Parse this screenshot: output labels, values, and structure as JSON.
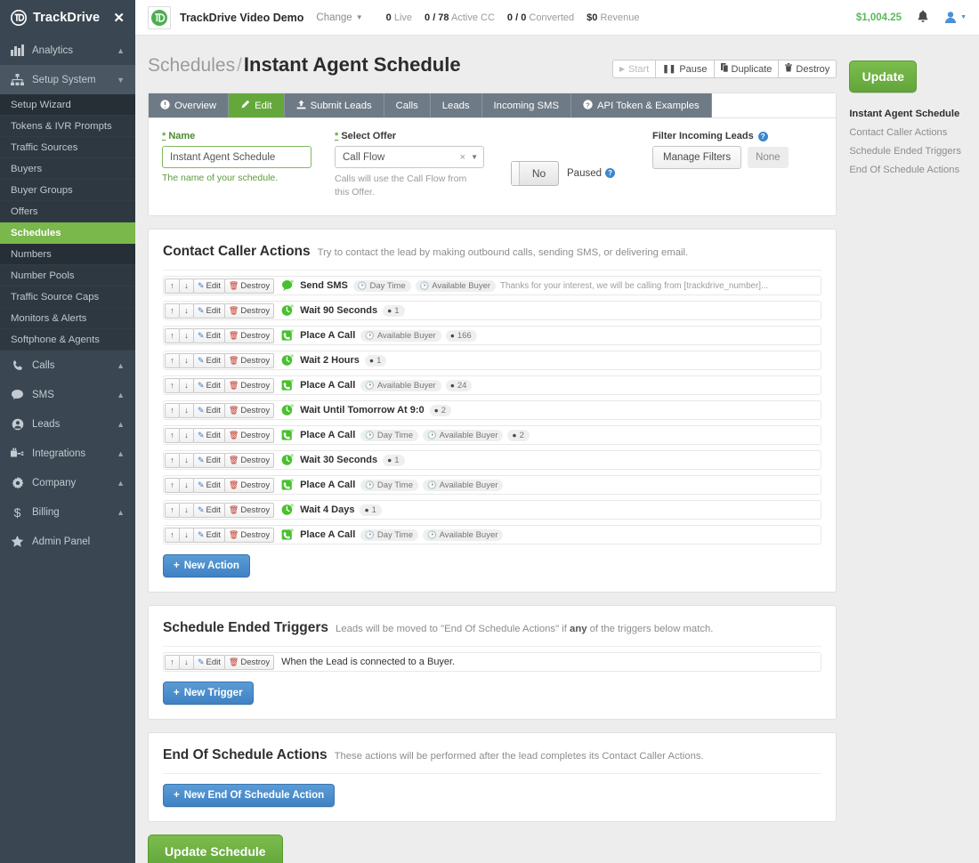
{
  "sidebar": {
    "brand": "TrackDrive",
    "close_icon": "close-icon",
    "groups": [
      {
        "label": "Analytics",
        "icon": "analytics-icon",
        "state": "collapsed"
      },
      {
        "label": "Setup System",
        "icon": "sitemap-icon",
        "state": "expanded"
      }
    ],
    "setup_items": [
      "Setup Wizard",
      "Tokens & IVR Prompts",
      "Traffic Sources",
      "Buyers",
      "Buyer Groups",
      "Offers",
      "Schedules",
      "Numbers",
      "Number Pools",
      "Traffic Source Caps",
      "Monitors & Alerts",
      "Softphone & Agents"
    ],
    "active_item": "Schedules",
    "lower_groups": [
      {
        "label": "Calls",
        "icon": "phone-icon"
      },
      {
        "label": "SMS",
        "icon": "chat-icon"
      },
      {
        "label": "Leads",
        "icon": "user-circle-icon"
      },
      {
        "label": "Integrations",
        "icon": "plug-icon"
      },
      {
        "label": "Company",
        "icon": "gear-icon"
      },
      {
        "label": "Billing",
        "icon": "dollar-icon"
      },
      {
        "label": "Admin Panel",
        "icon": "star-icon"
      }
    ],
    "accent_green": "#7ab84b",
    "bg": "#3a4651"
  },
  "topbar": {
    "tenant": "TrackDrive Video Demo",
    "change_label": "Change",
    "stats": [
      {
        "value": "0",
        "label": "Live"
      },
      {
        "value": "0 / 78",
        "label": "Active CC"
      },
      {
        "value": "0 / 0",
        "label": "Converted"
      },
      {
        "value": "$0",
        "label": "Revenue"
      }
    ],
    "revenue": "$1,004.25",
    "bell_icon": "bell-icon",
    "user_icon": "user-icon"
  },
  "page": {
    "breadcrumb_parent": "Schedules",
    "breadcrumb_sep": "/",
    "title": "Instant Agent Schedule",
    "actions": [
      {
        "label": "Start",
        "icon": "play-icon",
        "disabled": true
      },
      {
        "label": "Pause",
        "icon": "pause-icon",
        "disabled": false
      },
      {
        "label": "Duplicate",
        "icon": "copy-icon",
        "disabled": false
      },
      {
        "label": "Destroy",
        "icon": "trash-icon",
        "disabled": false
      }
    ]
  },
  "tabs": [
    {
      "label": "Overview",
      "icon": "info-icon",
      "active": false
    },
    {
      "label": "Edit",
      "icon": "pencil-icon",
      "active": true
    },
    {
      "label": "Submit Leads",
      "icon": "upload-icon",
      "active": false
    },
    {
      "label": "Calls",
      "icon": "",
      "active": false
    },
    {
      "label": "Leads",
      "icon": "",
      "active": false
    },
    {
      "label": "Incoming SMS",
      "icon": "",
      "active": false
    },
    {
      "label": "API Token & Examples",
      "icon": "question-icon",
      "active": false
    }
  ],
  "form": {
    "name_label": "Name",
    "name_value": "Instant Agent Schedule",
    "name_help": "The name of your schedule.",
    "offer_label": "Select Offer",
    "offer_value": "Call Flow",
    "offer_help": "Calls will use the Call Flow from this Offer.",
    "paused_toggle_value": "No",
    "paused_label": "Paused",
    "filter_label": "Filter Incoming Leads",
    "manage_filters_label": "Manage Filters",
    "filter_status": "None",
    "required_mark": "*"
  },
  "contact_caller_actions": {
    "title": "Contact Caller Actions",
    "subtitle": "Try to contact the lead by making outbound calls, sending SMS, or delivering email.",
    "row_buttons": {
      "up": "↑",
      "down": "↓",
      "edit": "Edit",
      "destroy": "Destroy"
    },
    "new_button": "New Action",
    "rows": [
      {
        "icon": "sms-bubble-icon",
        "name": "Send SMS",
        "chips": [
          "Day Time",
          "Available Buyer"
        ],
        "counts": [],
        "preview": "Thanks for your interest, we will be calling from [trackdrive_number]..."
      },
      {
        "icon": "clock-icon",
        "name": "Wait 90 Seconds",
        "chips": [],
        "counts": [
          "1"
        ],
        "preview": ""
      },
      {
        "icon": "phone-square-icon",
        "name": "Place A Call",
        "chips": [
          "Available Buyer"
        ],
        "counts": [
          "166"
        ],
        "preview": ""
      },
      {
        "icon": "clock-icon",
        "name": "Wait 2 Hours",
        "chips": [],
        "counts": [
          "1"
        ],
        "preview": ""
      },
      {
        "icon": "phone-square-icon",
        "name": "Place A Call",
        "chips": [
          "Available Buyer"
        ],
        "counts": [
          "24"
        ],
        "preview": ""
      },
      {
        "icon": "clock-icon",
        "name": "Wait Until Tomorrow At 9:0",
        "chips": [],
        "counts": [
          "2"
        ],
        "preview": ""
      },
      {
        "icon": "phone-square-icon",
        "name": "Place A Call",
        "chips": [
          "Day Time",
          "Available Buyer"
        ],
        "counts": [
          "2"
        ],
        "preview": ""
      },
      {
        "icon": "clock-icon",
        "name": "Wait 30 Seconds",
        "chips": [],
        "counts": [
          "1"
        ],
        "preview": ""
      },
      {
        "icon": "phone-square-icon",
        "name": "Place A Call",
        "chips": [
          "Day Time",
          "Available Buyer"
        ],
        "counts": [],
        "preview": ""
      },
      {
        "icon": "clock-icon",
        "name": "Wait 4 Days",
        "chips": [],
        "counts": [
          "1"
        ],
        "preview": ""
      },
      {
        "icon": "phone-square-icon",
        "name": "Place A Call",
        "chips": [
          "Day Time",
          "Available Buyer"
        ],
        "counts": [],
        "preview": ""
      }
    ]
  },
  "schedule_ended_triggers": {
    "title": "Schedule Ended Triggers",
    "subtitle_pre": "Leads will be moved to \"End Of Schedule Actions\" if ",
    "subtitle_bold": "any",
    "subtitle_post": " of the triggers below match.",
    "new_button": "New Trigger",
    "rows": [
      {
        "text": "When the Lead is connected to a Buyer."
      }
    ]
  },
  "end_of_schedule_actions": {
    "title": "End Of Schedule Actions",
    "subtitle": "These actions will be performed after the lead completes its Contact Caller Actions.",
    "new_button": "New End Of Schedule Action"
  },
  "footer": {
    "update_schedule_label": "Update Schedule"
  },
  "rail": {
    "update_label": "Update",
    "links": [
      {
        "label": "Instant Agent Schedule",
        "current": true
      },
      {
        "label": "Contact Caller Actions",
        "current": false
      },
      {
        "label": "Schedule Ended Triggers",
        "current": false
      },
      {
        "label": "End Of Schedule Actions",
        "current": false
      }
    ]
  }
}
